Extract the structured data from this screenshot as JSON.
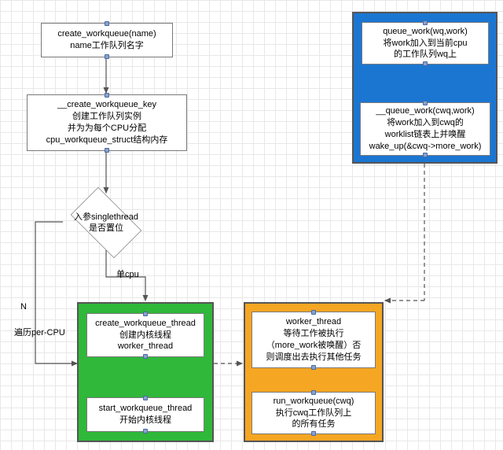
{
  "boxes": {
    "a": {
      "l1": "create_workqueue(name)",
      "l2": "name工作队列名字"
    },
    "b": {
      "l1": "__create_workqueue_key",
      "l2": "创建工作队列实例",
      "l3": "并为为每个CPU分配",
      "l4": "cpu_workqueue_struct结构内存"
    },
    "c": {
      "l1": "入参singlethread",
      "l2": "是否置位"
    },
    "d": {
      "l1": "create_workqueue_thread",
      "l2": "创建内核线程",
      "l3": "worker_thread"
    },
    "e": {
      "l1": "start_workqueue_thread",
      "l2": "开始内核线程"
    },
    "f": {
      "l1": "worker_thread",
      "l2": "等待工作被执行",
      "l3": "（more_work被唤醒）否",
      "l4": "则调度出去执行其他任务"
    },
    "g": {
      "l1": "run_workqueue(cwq)",
      "l2": "执行cwq工作队列上",
      "l3": "的所有任务"
    },
    "h": {
      "l1": "queue_work(wq,work)",
      "l2": "将work加入到当前cpu",
      "l3": "的工作队列wq上"
    },
    "i": {
      "l1": "__queue_work(cwq,work)",
      "l2": "将work加入到cwq的",
      "l3": "worklist链表上并唤醒",
      "l4": "wake_up(&cwq->more_work)"
    }
  },
  "labels": {
    "single_cpu": "单cpu",
    "n": "N",
    "loop": "遍历per-CPU"
  }
}
